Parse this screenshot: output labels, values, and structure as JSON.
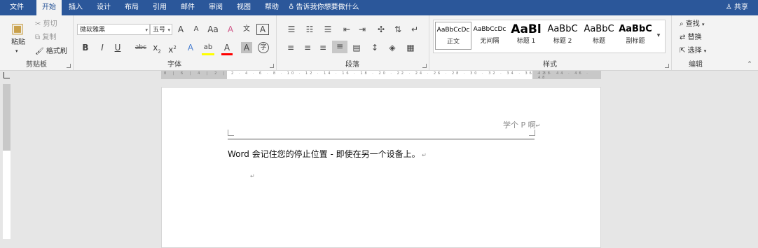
{
  "tabs": [
    "文件",
    "开始",
    "插入",
    "设计",
    "布局",
    "引用",
    "邮件",
    "审阅",
    "视图",
    "帮助"
  ],
  "active_tab": "开始",
  "tell_me": "告诉我你想要做什么",
  "share": "共享",
  "clipboard": {
    "paste": "粘贴",
    "cut": "剪切",
    "copy": "复制",
    "format_painter": "格式刷",
    "label": "剪贴板"
  },
  "font": {
    "name": "微软雅黑",
    "size": "五号",
    "label": "字体",
    "grow": "A",
    "shrink": "A",
    "case": "Aa",
    "clear": "A",
    "pinyin": "文",
    "border": "A",
    "bold": "B",
    "italic": "I",
    "underline": "U",
    "strike": "abc",
    "sub": "x",
    "sub_n": "2",
    "sup": "x",
    "sup_n": "2",
    "effects": "A",
    "highlight": "ab",
    "color": "A",
    "shade": "A",
    "circle": "字"
  },
  "paragraph": {
    "label": "段落"
  },
  "styles": {
    "label": "样式",
    "items": [
      {
        "sample": "AaBbCcDc",
        "name": "正文"
      },
      {
        "sample": "AaBbCcDc",
        "name": "无间隔"
      },
      {
        "sample": "AaBl",
        "name": "标题 1"
      },
      {
        "sample": "AaBbC",
        "name": "标题 2"
      },
      {
        "sample": "AaBbC",
        "name": "标题"
      },
      {
        "sample": "AaBbC",
        "name": "副标题"
      }
    ]
  },
  "editing": {
    "find": "查找",
    "replace": "替换",
    "select": "选择",
    "label": "编辑"
  },
  "document": {
    "header_text": "学个 P 啊",
    "body_text": "Word 会记住您的停止位置 - 即使在另一个设备上。"
  },
  "colors": {
    "brand": "#2b579a",
    "highlight": "#ffff00",
    "font_color": "#ff0000"
  }
}
